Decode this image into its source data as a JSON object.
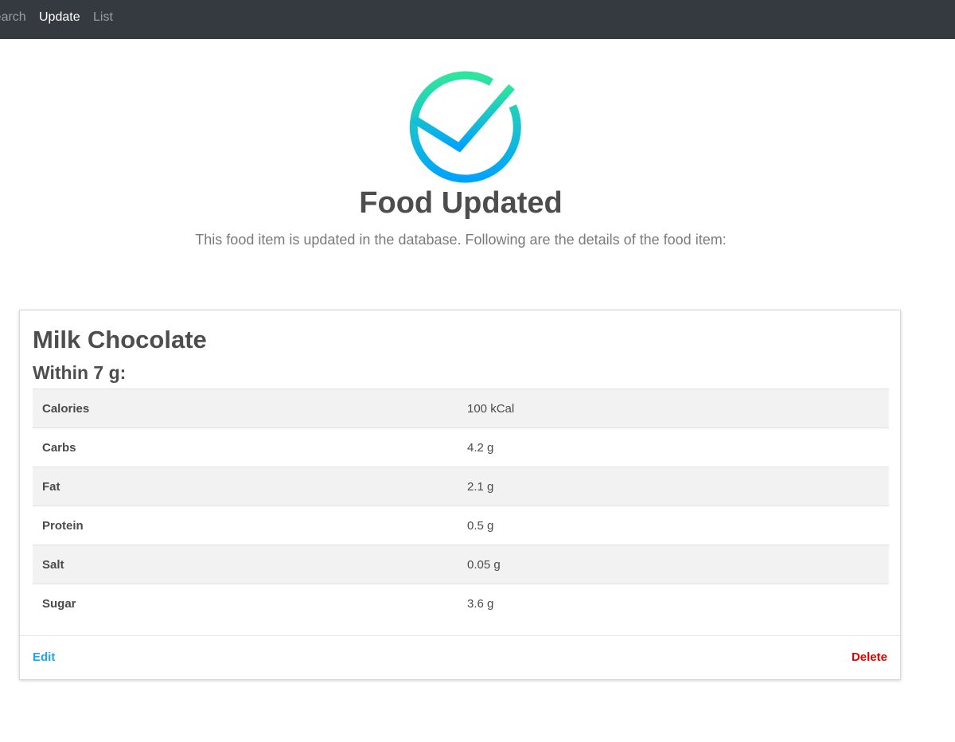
{
  "nav": {
    "items": [
      {
        "label": "Search"
      },
      {
        "label": "Update"
      },
      {
        "label": "List"
      }
    ],
    "active": "Update"
  },
  "status": {
    "icon": "check-circle-icon",
    "title": "Food Updated",
    "message": "This food item is updated in the database. Following are the details of the food item:"
  },
  "food": {
    "name": "Milk Chocolate",
    "portion": "Within 7 g:",
    "nutrients": [
      {
        "label": "Calories",
        "value": "100 kCal"
      },
      {
        "label": "Carbs",
        "value": "4.2 g"
      },
      {
        "label": "Fat",
        "value": "2.1 g"
      },
      {
        "label": "Protein",
        "value": "0.5 g"
      },
      {
        "label": "Salt",
        "value": "0.05 g"
      },
      {
        "label": "Sugar",
        "value": "3.6 g"
      }
    ]
  },
  "actions": {
    "edit_label": "Edit",
    "delete_label": "Delete"
  },
  "colors": {
    "navbar": "#343a40",
    "icon_gradient_start": "#2ee59d",
    "icon_gradient_end": "#00a2ff",
    "edit": "#1ea7e8",
    "delete": "#e00000"
  }
}
